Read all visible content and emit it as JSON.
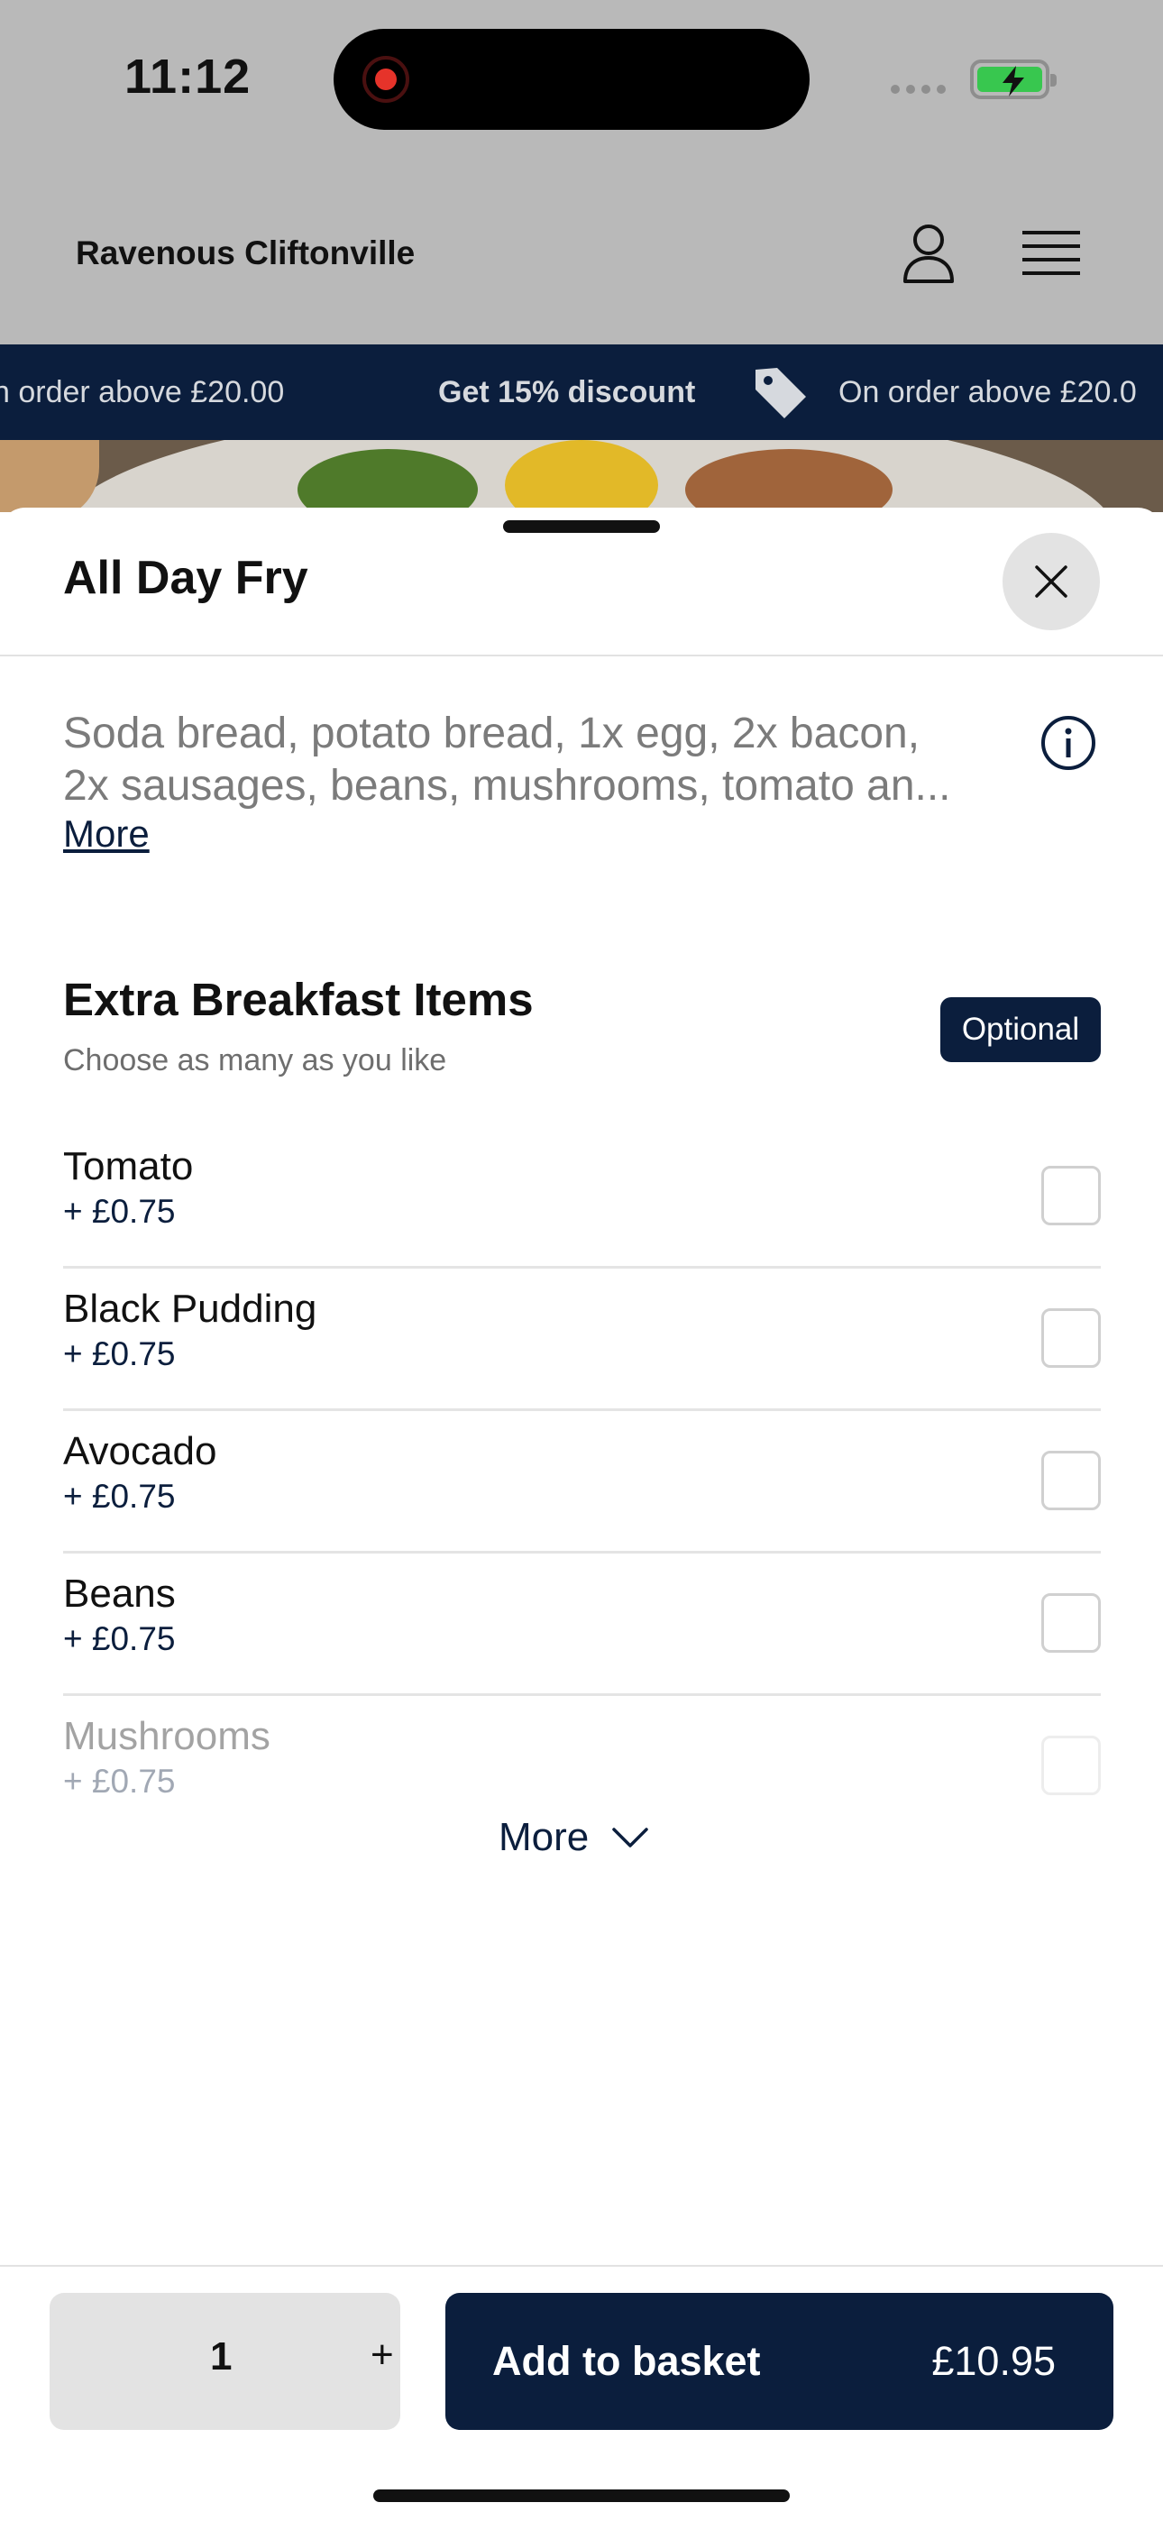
{
  "status_bar": {
    "time": "11:12"
  },
  "header": {
    "restaurant_name": "Ravenous Cliftonville"
  },
  "promo": {
    "text_left": "n order above £20.00",
    "text_center": "Get 15% discount",
    "text_right": "On order above £20.0"
  },
  "item": {
    "title": "All Day Fry",
    "description_line1": "Soda bread, potato bread, 1x egg, 2x bacon,",
    "description_line2": "2x sausages, beans, mushrooms, tomato an...",
    "more_link": "More"
  },
  "section": {
    "title": "Extra Breakfast Items",
    "subtitle": "Choose as many as you like",
    "badge": "Optional",
    "options": [
      {
        "name": "Tomato",
        "price": "+ £0.75"
      },
      {
        "name": "Black Pudding",
        "price": "+ £0.75"
      },
      {
        "name": "Avocado",
        "price": "+ £0.75"
      },
      {
        "name": "Beans",
        "price": "+ £0.75"
      },
      {
        "name": "Mushrooms",
        "price": "+ £0.75"
      }
    ],
    "more_button": "More"
  },
  "footer": {
    "quantity": "1",
    "plus_label": "+",
    "add_label": "Add to basket",
    "total": "£10.95"
  }
}
